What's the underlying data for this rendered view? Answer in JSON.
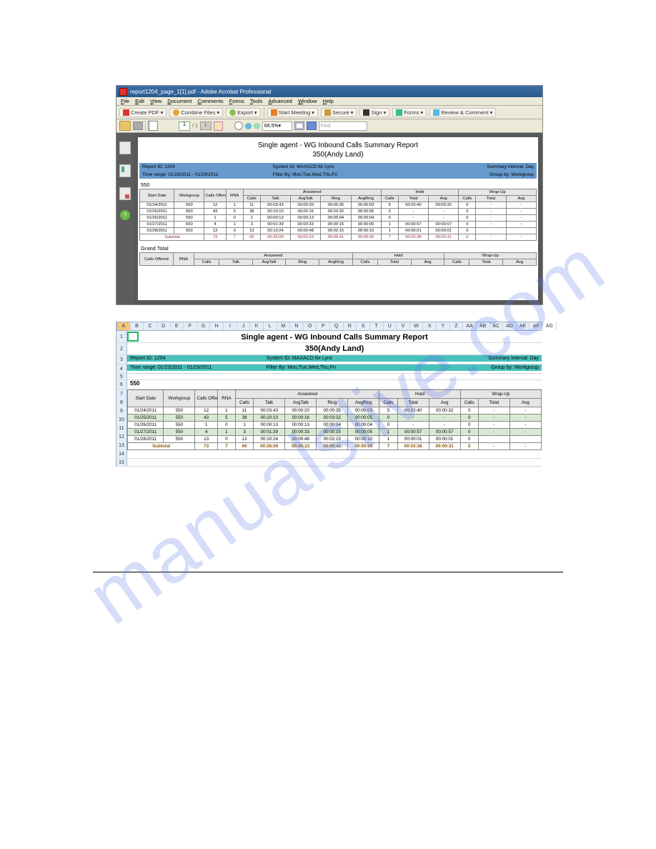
{
  "acrobat": {
    "window_title": "report1204_page_1[1].pdf - Adobe Acrobat Professional",
    "menus": [
      "File",
      "Edit",
      "View",
      "Document",
      "Comments",
      "Forms",
      "Tools",
      "Advanced",
      "Window",
      "Help"
    ],
    "toolbar1": {
      "create_pdf": "Create PDF",
      "combine": "Combine Files",
      "export": "Export",
      "start_meeting": "Start Meeting",
      "secure": "Secure",
      "sign": "Sign",
      "forms": "Forms",
      "review": "Review & Comment"
    },
    "toolbar2": {
      "page_current": "1",
      "page_total": "/ 1",
      "select_label": "I",
      "zoom": "66.5%",
      "find_placeholder": "Find"
    },
    "nav_help": "?"
  },
  "report": {
    "title": "Single agent - WG Inbound Calls Summary Report",
    "subtitle": "350(Andy Land)",
    "meta": {
      "left1": "Report ID: 1204",
      "left2": "Time range: 01/23/2011 - 01/29/2011",
      "mid1": "System ID: MAXACD for Lync",
      "mid2": "Filter By: Mon,Tue,Wed,Thu,Fri",
      "right1": "Summary interval: Day",
      "right2": "Group by: Workgroup"
    },
    "group": "550",
    "headers": {
      "start_date": "Start Date",
      "workgroup": "Workgroup",
      "calls_offered": "Calls Offered",
      "rna": "RNA",
      "answered": "Answered",
      "calls": "Calls",
      "talk": "Talk",
      "avgtalk": "AvgTalk",
      "ring": "Ring",
      "avgring": "AvgRing",
      "hold": "Hold",
      "total": "Total",
      "avg": "Avg",
      "wrapup": "Wrap-Up"
    },
    "rows": [
      {
        "date": "01/24/2011",
        "wg": "550",
        "offered": "12",
        "rna": "1",
        "a_calls": "11",
        "talk": "00:03:43",
        "avgtalk": "00:00:20",
        "ring": "00:00:35",
        "avgring": "00:00:03",
        "h_calls": "5",
        "h_total": "00:02:40",
        "h_avg": "00:00:32",
        "w_calls": "0",
        "w_total": "-",
        "w_avg": "-"
      },
      {
        "date": "01/25/2011",
        "wg": "550",
        "offered": "43",
        "rna": "5",
        "a_calls": "38",
        "talk": "00:10:10",
        "avgtalk": "00:00:16",
        "ring": "00:03:32",
        "avgring": "00:00:05",
        "h_calls": "0",
        "h_total": "-",
        "h_avg": "-",
        "w_calls": "0",
        "w_total": "-",
        "w_avg": "-"
      },
      {
        "date": "01/26/2011",
        "wg": "550",
        "offered": "1",
        "rna": "0",
        "a_calls": "1",
        "talk": "00:00:13",
        "avgtalk": "00:00:13",
        "ring": "00:00:04",
        "avgring": "00:00:04",
        "h_calls": "0",
        "h_total": "-",
        "h_avg": "-",
        "w_calls": "0",
        "w_total": "-",
        "w_avg": "-"
      },
      {
        "date": "01/27/2011",
        "wg": "550",
        "offered": "4",
        "rna": "1",
        "a_calls": "3",
        "talk": "00:01:39",
        "avgtalk": "00:00:33",
        "ring": "00:00:15",
        "avgring": "00:00:05",
        "h_calls": "1",
        "h_total": "00:00:57",
        "h_avg": "00:00:57",
        "w_calls": "0",
        "w_total": "-",
        "w_avg": "-"
      },
      {
        "date": "01/28/2011",
        "wg": "550",
        "offered": "13",
        "rna": "0",
        "a_calls": "13",
        "talk": "00:10:24",
        "avgtalk": "00:00:48",
        "ring": "00:02:15",
        "avgring": "00:00:10",
        "h_calls": "1",
        "h_total": "00:00:01",
        "h_avg": "00:00:01",
        "w_calls": "0",
        "w_total": "",
        "w_avg": ""
      }
    ],
    "subtotal": {
      "label": "Subtotal",
      "offered": "73",
      "rna": "7",
      "a_calls": "66",
      "talk": "00:26:09",
      "avgtalk": "00:00:23",
      "ring": "00:06:41",
      "avgring": "00:00:06",
      "h_calls": "7",
      "h_total": "00:03:38",
      "h_avg": "00:00:31",
      "w_calls": "0",
      "w_total": "-",
      "w_avg": "-"
    },
    "grand_total_label": "Grand Total"
  },
  "excel": {
    "cols": [
      "A",
      "B",
      "C",
      "D",
      "E",
      "F",
      "G",
      "H",
      "I",
      "J",
      "K",
      "L",
      "M",
      "N",
      "O",
      "P",
      "Q",
      "R",
      "S",
      "T",
      "U",
      "V",
      "W",
      "X",
      "Y",
      "Z",
      "AA",
      "AB",
      "AC",
      "AD",
      "AE",
      "AF",
      "AG"
    ],
    "rownums": [
      "1",
      "2",
      "3",
      "4",
      "5",
      "6",
      "7",
      "8",
      "9",
      "10",
      "11",
      "12",
      "13",
      "14",
      "15"
    ],
    "title": "Single agent - WG Inbound Calls Summary Report",
    "subtitle": "350(Andy Land)"
  },
  "watermark": "manualslive.com"
}
